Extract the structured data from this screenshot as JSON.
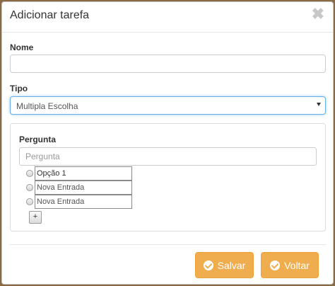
{
  "modal": {
    "title": "Adicionar tarefa",
    "close_glyph": "✖"
  },
  "form": {
    "nome_label": "Nome",
    "nome_value": "",
    "tipo_label": "Tipo",
    "tipo_selected": "Multipla Escolha"
  },
  "pergunta": {
    "label": "Pergunta",
    "placeholder": "Pergunta",
    "options": [
      {
        "value": "Opção 1",
        "placeholder": ""
      },
      {
        "value": "",
        "placeholder": "Nova Entrada"
      },
      {
        "value": "",
        "placeholder": "Nova Entrada"
      }
    ],
    "add_label": "+"
  },
  "footer": {
    "save_label": "Salvar",
    "back_label": "Voltar"
  },
  "colors": {
    "accent": "#f0ad4e",
    "focus": "#66afe9"
  }
}
